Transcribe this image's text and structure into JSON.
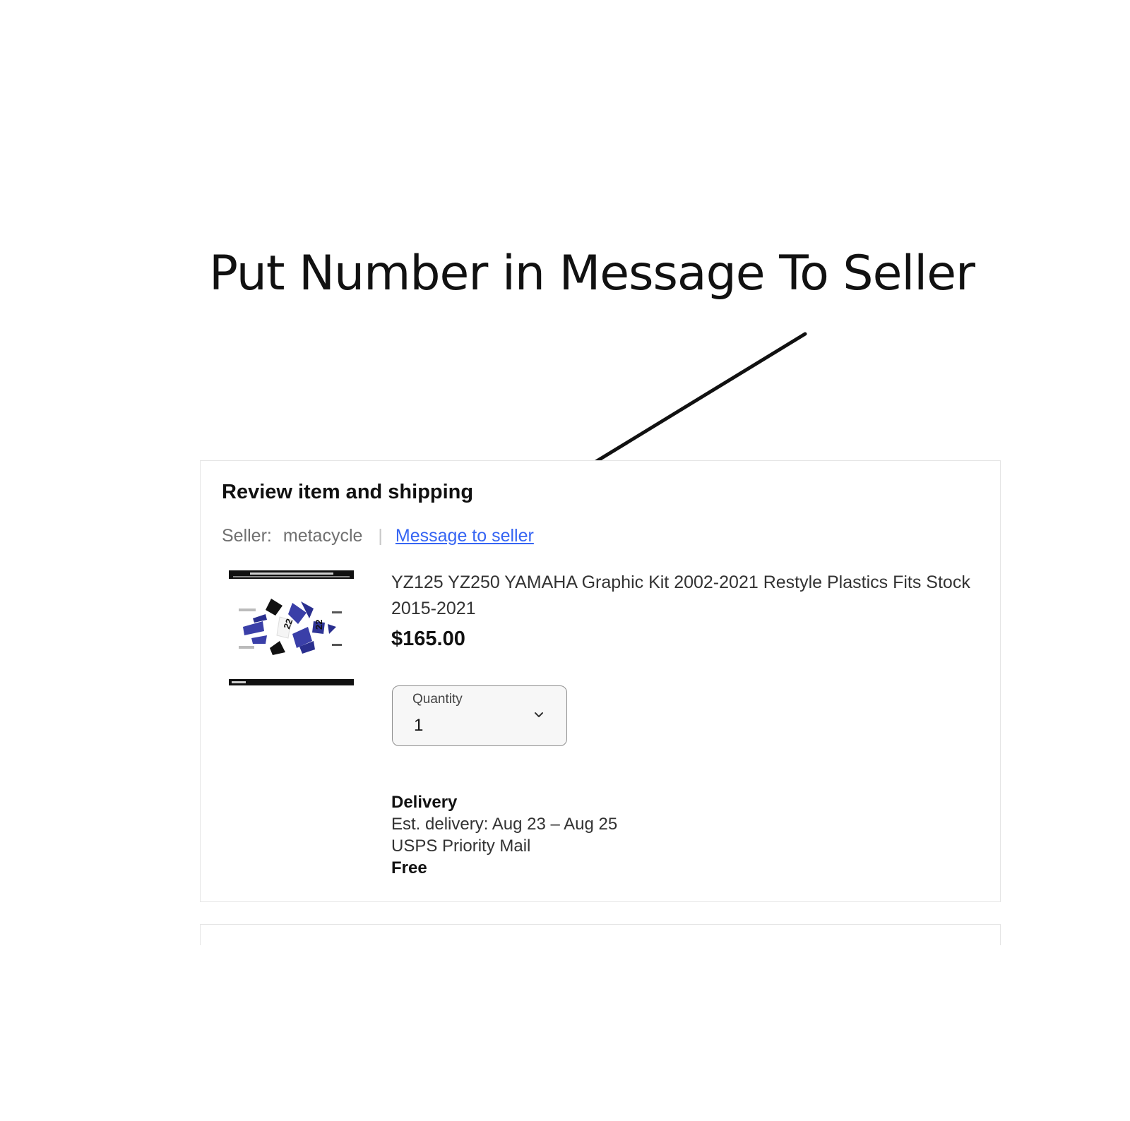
{
  "annotation": {
    "title": "Put Number in Message To Seller"
  },
  "review": {
    "title": "Review item and shipping",
    "seller_label": "Seller:",
    "seller_name": "metacycle",
    "separator": "|",
    "message_link": "Message to seller"
  },
  "item": {
    "image": "graphic-kit-thumbnail",
    "title": "YZ125 YZ250 YAMAHA Graphic Kit 2002-2021 Restyle Plastics Fits Stock 2015-2021",
    "price": "$165.00",
    "quantity_label": "Quantity",
    "quantity_value": "1"
  },
  "delivery": {
    "heading": "Delivery",
    "estimate": "Est. delivery: Aug 23 – Aug 25",
    "service": "USPS Priority Mail",
    "cost": "Free"
  },
  "colors": {
    "link": "#3665f3",
    "border": "#e5e5e5",
    "text": "#111111",
    "muted": "#707070"
  },
  "icons": {
    "annotation_arrow": "arrow-icon",
    "quantity_dropdown": "chevron-down-icon"
  }
}
